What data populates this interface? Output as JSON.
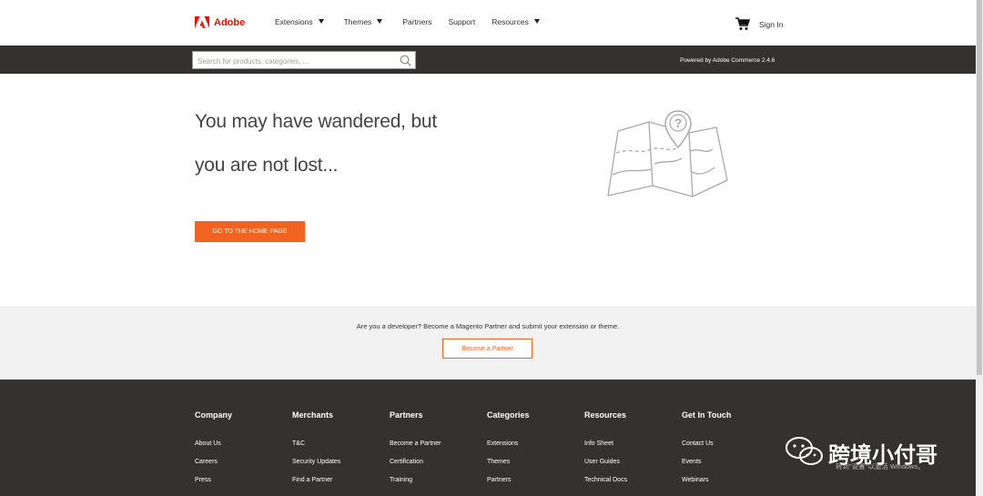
{
  "header": {
    "logo_text": "Adobe",
    "nav": [
      {
        "label": "Extensions",
        "dropdown": true
      },
      {
        "label": "Themes",
        "dropdown": true
      },
      {
        "label": "Partners",
        "dropdown": false
      },
      {
        "label": "Support",
        "dropdown": false
      },
      {
        "label": "Resources",
        "dropdown": true
      }
    ],
    "signin_label": "Sign In",
    "cart_icon": "cart-icon"
  },
  "searchbar": {
    "placeholder": "Search for products, categories, ...",
    "value": "",
    "powered_by": "Powered by Adobe Commerce 2.4.6"
  },
  "main": {
    "headline_line1": "You may have wandered, but",
    "headline_line2": "you are not lost...",
    "home_button_label": "GO TO THE HOME PAGE",
    "illustration_icon": "map-pin-icon"
  },
  "developer": {
    "text": "Are you a developer? Become a Magento Partner and submit your extension or theme.",
    "button_label": "Become a Partner"
  },
  "footer": {
    "columns": [
      {
        "title": "Company",
        "links": [
          "About Us",
          "Careers",
          "Press"
        ]
      },
      {
        "title": "Merchants",
        "links": [
          "T&C",
          "Security Updates",
          "Find a Partner"
        ]
      },
      {
        "title": "Partners",
        "links": [
          "Become a Partner",
          "Certification",
          "Training"
        ]
      },
      {
        "title": "Categories",
        "links": [
          "Extensions",
          "Themes",
          "Partners"
        ]
      },
      {
        "title": "Resources",
        "links": [
          "Info Sheet",
          "User Guides",
          "Technical Docs"
        ]
      },
      {
        "title": "Get In Touch",
        "links": [
          "Contact Us",
          "Events",
          "Webinars"
        ]
      }
    ]
  },
  "watermark": {
    "text": "跨境小付哥",
    "sub": "转到\"设置\"以激活 Windows。"
  },
  "colors": {
    "accent": "#f26322",
    "dark_band": "#333230",
    "adobe_red": "#eb1000",
    "light_band": "#f2f2f2"
  }
}
